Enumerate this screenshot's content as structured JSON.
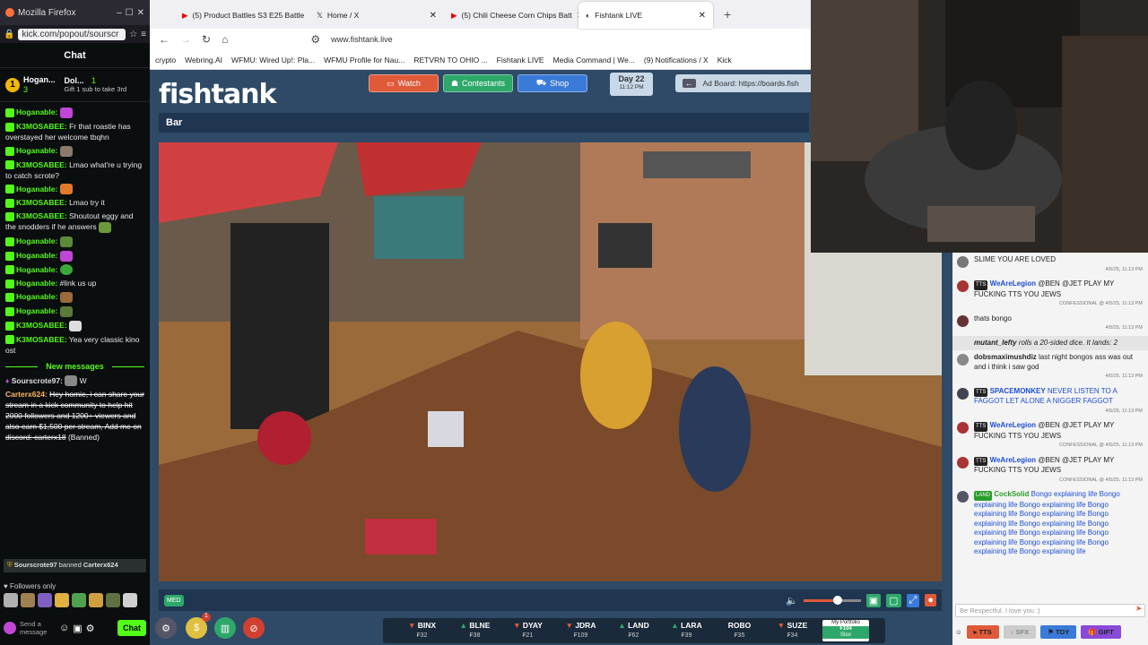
{
  "kick": {
    "tab_title": "Mozilla Firefox",
    "url": "kick.com/popout/sourscr",
    "chat_header": "Chat",
    "gifter1": {
      "name": "Hogan...",
      "count": "3"
    },
    "gifter2": {
      "name": "Dol...",
      "count": "1",
      "note": "Gift 1 sub to take 3rd"
    },
    "messages": [
      {
        "user": "Hoganable:",
        "text": ""
      },
      {
        "user": "K3MOSABEE:",
        "text": "Fr that roastie has overstayed her welcome tbqhn"
      },
      {
        "user": "Hoganable:",
        "text": ""
      },
      {
        "user": "K3MOSABEE:",
        "text": "Lmao what're u trying to catch scrote?"
      },
      {
        "user": "Hoganable:",
        "text": ""
      },
      {
        "user": "K3MOSABEE:",
        "text": "Lmao try it"
      },
      {
        "user": "K3MOSABEE:",
        "text": "Shoutout eggy and the snodders if he answers"
      },
      {
        "user": "Hoganable:",
        "text": ""
      },
      {
        "user": "Hoganable:",
        "text": ""
      },
      {
        "user": "Hoganable:",
        "text": ""
      },
      {
        "user": "Hoganable:",
        "text": "#link us up"
      },
      {
        "user": "Hoganable:",
        "text": ""
      },
      {
        "user": "Hoganable:",
        "text": ""
      },
      {
        "user": "K3MOSABEE:",
        "text": ""
      },
      {
        "user": "K3MOSABEE:",
        "text": "Yea very classic kino ost"
      }
    ],
    "new_messages": "New messages",
    "after": [
      {
        "user": "Sourscrote97:",
        "text": "W"
      },
      {
        "user": "Carterx624:",
        "text": "Hey homie, i can share your stream in a kick community to help hit 2000 followers and 1200+ viewers and also earn $1,500 per stream, Add me on discord: carterx18",
        "tag": "(Banned)"
      }
    ],
    "ban_notice": {
      "mod": "Sourscrote97",
      "verb": "banned",
      "target": "Carterx624"
    },
    "followers_only": "Followers only",
    "send_placeholder": "Send a message",
    "chat_button": "Chat"
  },
  "browser": {
    "tabs": [
      {
        "title": "(5) Product Battles S3 E25 Battle"
      },
      {
        "title": "Home / X"
      },
      {
        "title": "(5) Chili Cheese Corn Chips Batt"
      },
      {
        "title": "Fishtank LIVE",
        "active": true
      }
    ],
    "url": "www.fishtank.live",
    "bookmarks": [
      "crypto",
      "Webring.AI",
      "WFMU: Wired Up!: Pla...",
      "WFMU Profile for Nau...",
      "RETVRN TO OHIO ...",
      "Fishtank LIVE",
      "Media Command | We...",
      "(9) Notifications / X",
      "Kick"
    ]
  },
  "fishtank": {
    "logo": "fishtank",
    "buttons": {
      "watch": "Watch",
      "contestants": "Contestants",
      "shop": "Shop"
    },
    "day": "Day 22",
    "time": "11:12 PM",
    "adboard": "Ad Board: https://boards.fish",
    "camera_name": "Bar",
    "live_badge": "MED",
    "stocks": [
      {
        "name": "BINX",
        "dir": "down",
        "price": "₣32"
      },
      {
        "name": "BLNE",
        "dir": "up",
        "price": "₣38"
      },
      {
        "name": "DYAY",
        "dir": "down",
        "price": "₣21"
      },
      {
        "name": "JDRA",
        "dir": "down",
        "price": "₣109"
      },
      {
        "name": "LAND",
        "dir": "up",
        "price": "₣62"
      },
      {
        "name": "LARA",
        "dir": "up",
        "price": "₣39"
      },
      {
        "name": "ROBO",
        "dir": "none",
        "price": "₣35"
      },
      {
        "name": "SUZE",
        "dir": "down",
        "price": "₣34"
      }
    ],
    "portfolio": {
      "label": "My Portfolio",
      "value": "₣104",
      "sub": "Stox"
    },
    "volume": 0.6,
    "badge_count": "1"
  },
  "right_chat": {
    "messages": [
      {
        "user": "",
        "text": "SLIME YOU ARE LOVED",
        "meta": "4/5/25, 11:13 PM"
      },
      {
        "user": "WeAreLegion",
        "text": "@BEN @JET PLAY MY FUCKING TTS YOU JEWS",
        "meta": "CONFESSIONAL @ 4/5/25, 11:13 PM"
      },
      {
        "user": "",
        "text": "thats bongo",
        "meta": "4/5/25, 11:13 PM"
      },
      {
        "user": "mutant_lefty",
        "text": "rolls a 20-sided dice. It lands: 2",
        "meta": ""
      },
      {
        "user": "dobsmaximushdiz",
        "text": "last night bongos ass was out and i think i saw god",
        "meta": "4/5/25, 11:13 PM"
      },
      {
        "user": "SPACEMONKEY",
        "text": "NEVER LISTEN TO A FAGGOT LET ALONE A NIGGER FAGGOT",
        "meta": "4/5/25, 11:13 PM"
      },
      {
        "user": "WeAreLegion",
        "text": "@BEN @JET PLAY MY FUCKING TTS YOU JEWS",
        "meta": "CONFESSIONAL @ 4/5/25, 11:13 PM"
      },
      {
        "user": "WeAreLegion",
        "text": "@BEN @JET PLAY MY FUCKING TTS YOU JEWS",
        "meta": "CONFESSIONAL @ 4/5/25, 11:13 PM"
      },
      {
        "user": "CockSolid",
        "text": "Bongo explaining life Bongo explaining life Bongo explaining life Bongo explaining life Bongo explaining life Bongo explaining life Bongo explaining life Bongo explaining life Bongo explaining life Bongo explaining life Bongo explaining life Bongo explaining life Bongo explaining life",
        "meta": ""
      }
    ],
    "input_placeholder": "Be Respectful. I love you :)",
    "buttons": {
      "tts": "TTS",
      "sfx": "SFX",
      "toy": "TOY",
      "gift": "GIFT"
    }
  }
}
